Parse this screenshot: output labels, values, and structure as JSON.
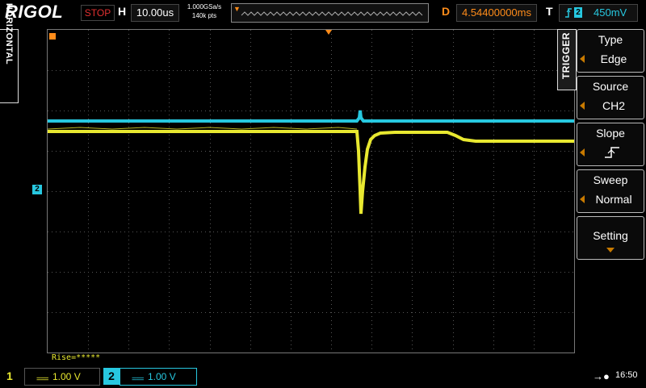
{
  "brand": {
    "logo": "RIGOL"
  },
  "header": {
    "run_state": "STOP",
    "h_label": "H",
    "timebase": "10.00us",
    "sample_rate": "1.000GSa/s",
    "mem_depth": "140k pts",
    "d_label": "D",
    "delay": "4.54400000ms",
    "t_label": "T",
    "trigger_channel": "2",
    "trigger_level": "450mV"
  },
  "tabs": {
    "horizontal": "HORIZONTAL",
    "trigger": "TRIGGER"
  },
  "menu": [
    {
      "title": "Type",
      "value": "Edge"
    },
    {
      "title": "Source",
      "value": "CH2"
    },
    {
      "title": "Slope",
      "value": ""
    },
    {
      "title": "Sweep",
      "value": "Normal"
    },
    {
      "title": "Setting",
      "value": ""
    }
  ],
  "markers": {
    "ch2_ground": "2"
  },
  "measurement": "Rise=*****",
  "channels": [
    {
      "id": "1",
      "coupling": "===",
      "scale": "1.00 V",
      "color": "#e8e830"
    },
    {
      "id": "2",
      "coupling": "===",
      "scale": "1.00 V",
      "color": "#27c8e0"
    }
  ],
  "status": {
    "usb": "usb-icon",
    "time": "16:50"
  },
  "colors": {
    "ch1": "#e8e830",
    "ch2": "#27c8e0",
    "accent": "#ff8c1a",
    "stop": "#e03030"
  }
}
